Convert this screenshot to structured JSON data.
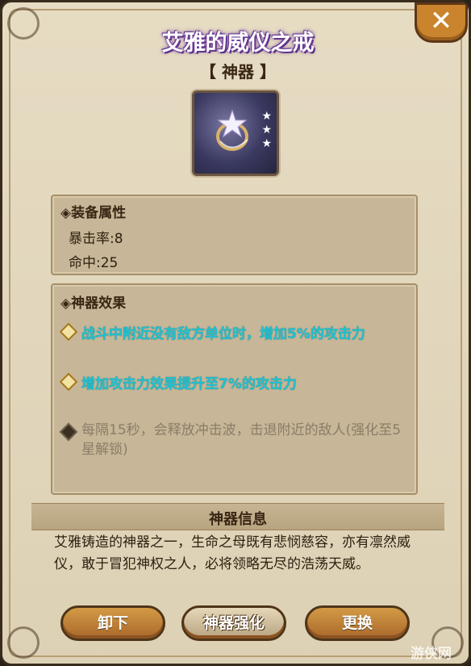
{
  "header": {
    "title": "艾雅的威仪之戒",
    "subtitle": "【 神器 】",
    "close_label": "✕"
  },
  "item_icon": {
    "name": "ring-icon",
    "stars": 3,
    "star_glyph": "★"
  },
  "attributes": {
    "heading": "◈装备属性",
    "lines": [
      "暴击率:8",
      "命中:25"
    ]
  },
  "effects": {
    "heading": "◈神器效果",
    "items": [
      {
        "text": "战斗中附近没有敌方单位时，增加5%的攻击力",
        "active": true
      },
      {
        "text": "增加攻击力效果提升至7%的攻击力",
        "active": true
      },
      {
        "text": "每隔15秒，会释放冲击波，击退附近的敌人(强化至5星解锁)",
        "active": false
      }
    ]
  },
  "info": {
    "title": "神器信息",
    "description": "艾雅铸造的神器之一，生命之母既有悲悯慈容，亦有凛然威仪，敢于冒犯神权之人，必将领略无尽的浩荡天威。"
  },
  "buttons": {
    "unequip": "卸下",
    "enhance": "神器强化",
    "replace": "更换"
  },
  "watermark": "游侠网",
  "colors": {
    "title_glow": "#6d3f9a",
    "effect_active": "#22c1d0",
    "effect_locked": "#8a7d68",
    "button": "#c9842d"
  }
}
